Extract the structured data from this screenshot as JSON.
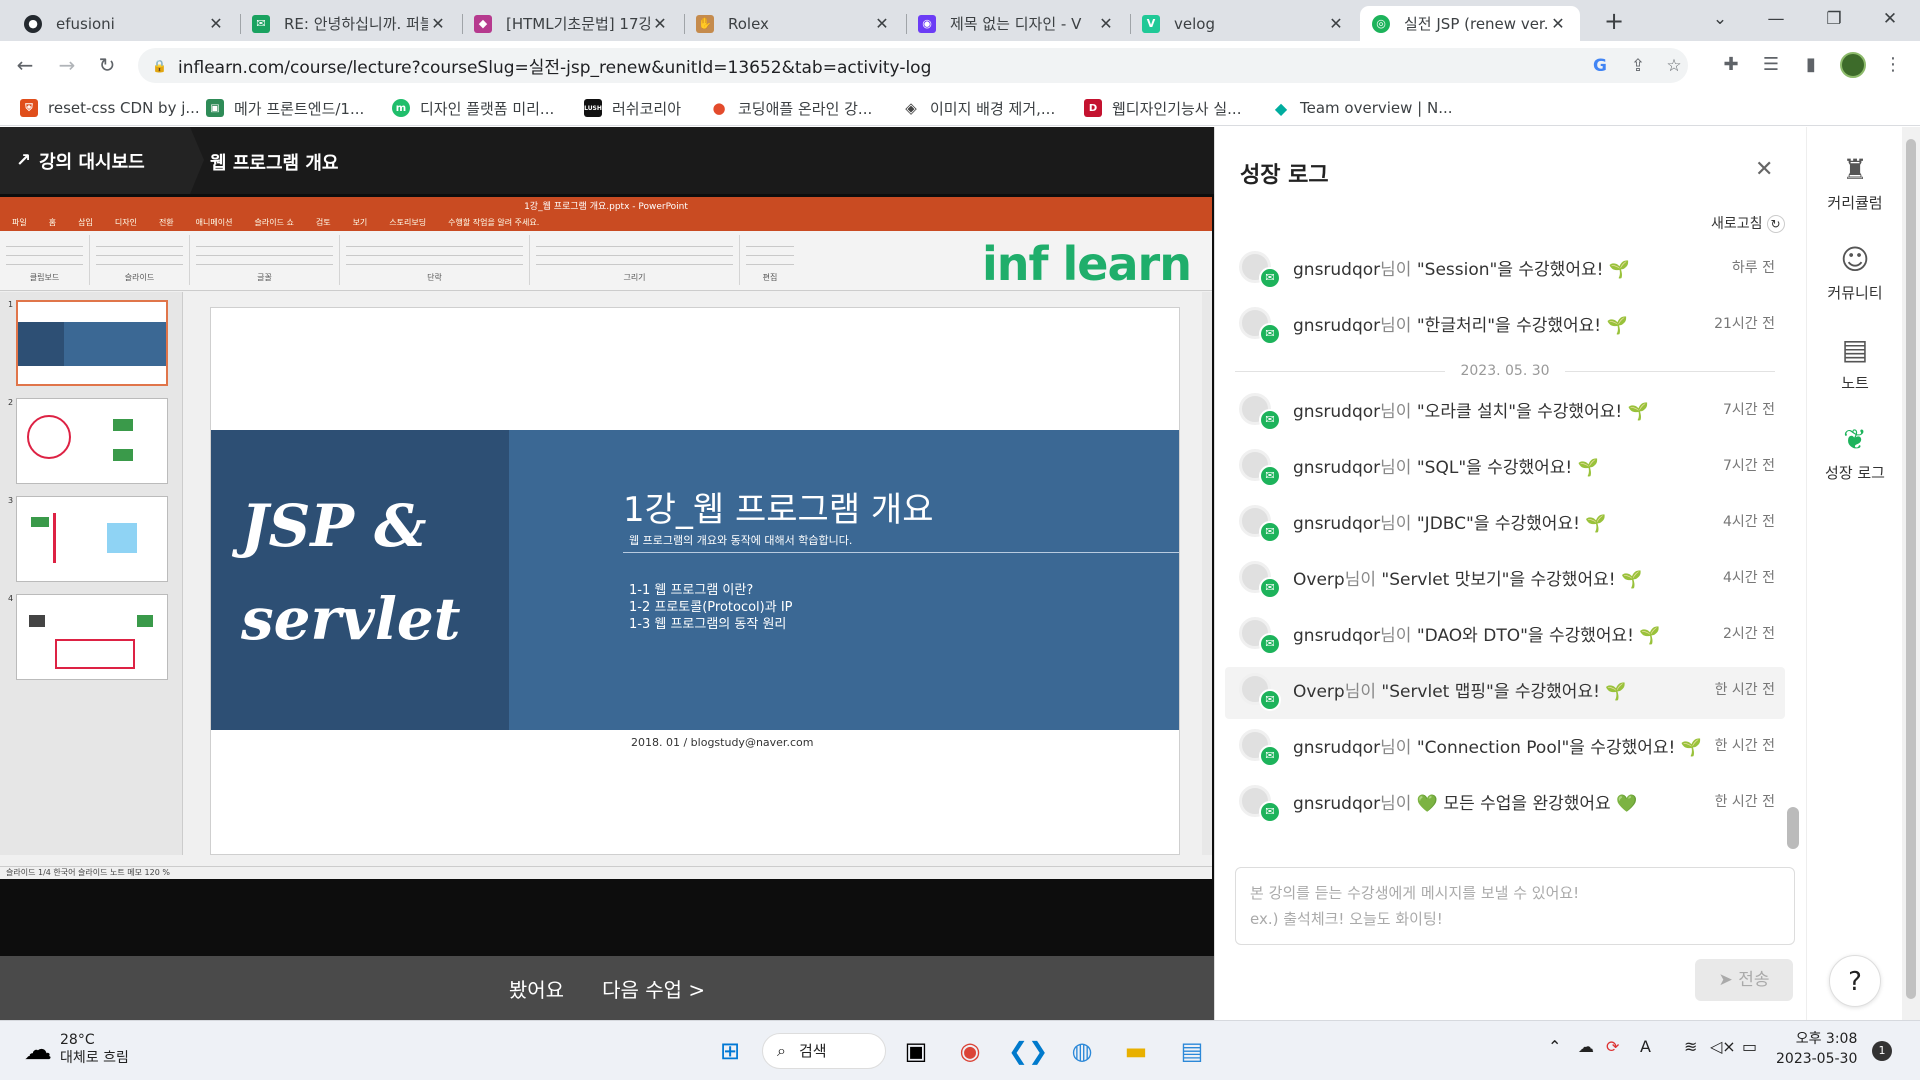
{
  "browser": {
    "tabs": [
      {
        "label": "efusioni",
        "icon": "github-icon",
        "color": "#24292f"
      },
      {
        "label": "RE: 안녕하십니까. 퍼블",
        "icon": "mail-icon",
        "color": "#1aa260"
      },
      {
        "label": "[HTML기초문법] 17강",
        "icon": "cube-icon",
        "color": "#b63a8e"
      },
      {
        "label": "Rolex",
        "icon": "hand-icon",
        "color": "#c58b4d"
      },
      {
        "label": "제목 없는 디자인 - V",
        "icon": "design-icon",
        "color": "#6c3cf5"
      },
      {
        "label": "velog",
        "icon": "velog-icon",
        "color": "#20c997"
      },
      {
        "label": "실전 JSP (renew ver.)",
        "icon": "inflearn-icon",
        "color": "#1db35b"
      }
    ],
    "url": "inflearn.com/course/lecture?courseSlug=실전-jsp_renew&unitId=13652&tab=activity-log",
    "bookmarks": [
      {
        "label": "reset-css CDN by j...",
        "color": "#e04e1b"
      },
      {
        "label": "메가 프론트엔드/1...",
        "color": "#2e8b57"
      },
      {
        "label": "디자인 플랫폼 미리...",
        "color": "#1fbe6b"
      },
      {
        "label": "러쉬코리아",
        "color": "#111111"
      },
      {
        "label": "코딩애플 온라인 강...",
        "color": "#e34b2c"
      },
      {
        "label": "이미지 배경 제거,...",
        "color": "#444444"
      },
      {
        "label": "웹디자인기능사 실...",
        "color": "#c4122f"
      },
      {
        "label": "Team overview | N...",
        "color": "#00ad9f"
      }
    ]
  },
  "lecture": {
    "dashboard_label": "강의 대시보드",
    "title": "웹 프로그램 개요",
    "watched_label": "봤어요",
    "next_label": "다음 수업 >"
  },
  "ppt": {
    "window_title": "1강_웹 프로그램 개요.pptx - PowerPoint",
    "menu": [
      "파일",
      "홈",
      "삽입",
      "디자인",
      "전환",
      "애니메이션",
      "슬라이드 쇼",
      "검토",
      "보기",
      "스토리보딩",
      "수행할 작업을 알려 주세요."
    ],
    "ribbon_groups": [
      "클립보드",
      "슬라이드",
      "글꼴",
      "단락",
      "그리기",
      "편집"
    ],
    "logo": "inf learn",
    "slide": {
      "jsp_text": "JSP &",
      "servlet_text": "servlet",
      "heading": "1강_웹 프로그램 개요",
      "subheading": "웹 프로그램의 개요와 동작에 대해서 학습합니다.",
      "items": [
        "1-1 웹 프로그램 이란?",
        "1-2 프로토콜(Protocol)과 IP",
        "1-3 웹 프로그램의 동작 원리"
      ],
      "footer": "2018. 01 / blogstudy@naver.com"
    },
    "thumb_numbers": [
      "1",
      "2",
      "3",
      "4"
    ],
    "status": "슬라이드 1/4    한국어                                                                                                                                                                                                                               슬라이드 노트   메모                                            120 %"
  },
  "panel": {
    "title": "성장 로그",
    "refresh_label": "새로고침",
    "date_separator": "2023. 05. 30",
    "feed": [
      {
        "user": "gnsrudqor",
        "nim": "님이",
        "text": "\"Session\"을 수강했어요! 🌱",
        "time": "하루 전"
      },
      {
        "user": "gnsrudqor",
        "nim": "님이",
        "text": "\"한글처리\"을 수강했어요! 🌱",
        "time": "21시간 전"
      },
      {
        "user": "gnsrudqor",
        "nim": "님이",
        "text": "\"오라클 설치\"을 수강했어요! 🌱",
        "time": "7시간 전"
      },
      {
        "user": "gnsrudqor",
        "nim": "님이",
        "text": "\"SQL\"을 수강했어요! 🌱",
        "time": "7시간 전"
      },
      {
        "user": "gnsrudqor",
        "nim": "님이",
        "text": "\"JDBC\"을 수강했어요! 🌱",
        "time": "4시간 전"
      },
      {
        "user": "Overp",
        "nim": "님이",
        "text": "\"Servlet 맛보기\"을 수강했어요! 🌱",
        "time": "4시간 전"
      },
      {
        "user": "gnsrudqor",
        "nim": "님이",
        "text": "\"DAO와 DTO\"을 수강했어요! 🌱",
        "time": "2시간 전"
      },
      {
        "user": "Overp",
        "nim": "님이",
        "text": "\"Servlet 맵핑\"을 수강했어요! 🌱",
        "time": "한 시간 전"
      },
      {
        "user": "gnsrudqor",
        "nim": "님이",
        "text": "\"Connection Pool\"을 수강했어요! 🌱",
        "time": "한 시간 전"
      },
      {
        "user": "gnsrudqor",
        "nim": "님이",
        "text": "💚 모든 수업을 완강했어요 💚",
        "time": "한 시간 전"
      }
    ],
    "message_placeholder_line1": "본 강의를 듣는 수강생에게 메시지를 보낼 수 있어요!",
    "message_placeholder_line2": "ex.) 출석체크! 오늘도 화이팅!",
    "send_label": "전송"
  },
  "rail": {
    "items": [
      {
        "label": "커리큘럼",
        "icon": "curriculum-icon"
      },
      {
        "label": "커뮤니티",
        "icon": "community-icon"
      },
      {
        "label": "노트",
        "icon": "note-icon"
      },
      {
        "label": "성장 로그",
        "icon": "leaf-icon"
      }
    ],
    "help": "?"
  },
  "taskbar": {
    "temperature": "28°C",
    "weather": "대체로 흐림",
    "search_label": "검색",
    "time": "오후 3:08",
    "date": "2023-05-30",
    "notifications": "1"
  },
  "colors": {
    "accent": "#1db35b",
    "ppt_orange": "#c94b22",
    "slide_blue": "#3b6894"
  }
}
